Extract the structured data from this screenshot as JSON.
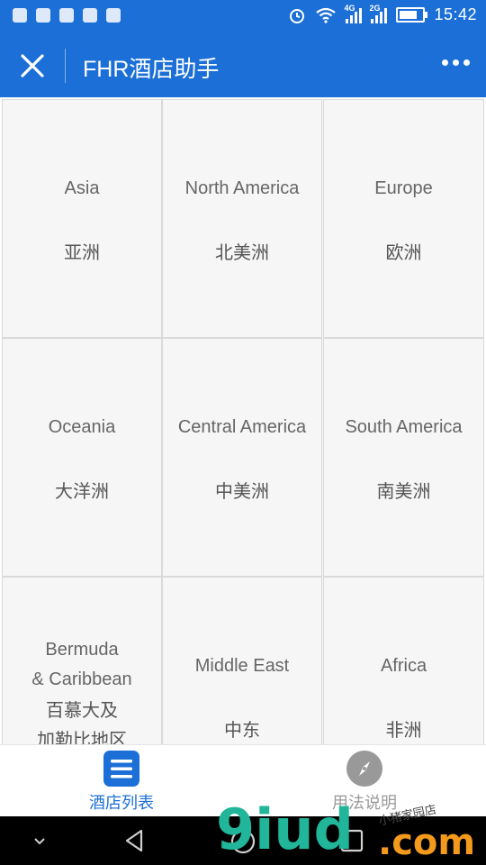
{
  "status_bar": {
    "time": "15:42",
    "network_1": "4G",
    "network_2": "2G"
  },
  "title_bar": {
    "title": "FHR酒店助手"
  },
  "regions": [
    {
      "en": "Asia",
      "zh": "亚洲"
    },
    {
      "en": "North America",
      "zh": "北美洲"
    },
    {
      "en": "Europe",
      "zh": "欧洲"
    },
    {
      "en": "Oceania",
      "zh": "大洋洲"
    },
    {
      "en": "Central America",
      "zh": "中美洲"
    },
    {
      "en": "South America",
      "zh": "南美洲"
    },
    {
      "en": "Bermuda\n& Caribbean",
      "zh": "百慕大及\n加勒比地区"
    },
    {
      "en": "Middle East",
      "zh": "中东"
    },
    {
      "en": "Africa",
      "zh": "非洲"
    }
  ],
  "tabs": [
    {
      "label": "酒店列表",
      "icon": "list-icon",
      "active": true,
      "color": "#1b6fd6"
    },
    {
      "label": "用法说明",
      "icon": "compass-icon",
      "active": false,
      "color": "#999999"
    }
  ],
  "watermark": {
    "brand": "9iud",
    "suffix": ".com",
    "caption": "小猪家园店"
  },
  "colors": {
    "primary": "#1b6fd6",
    "inactive": "#999999"
  }
}
